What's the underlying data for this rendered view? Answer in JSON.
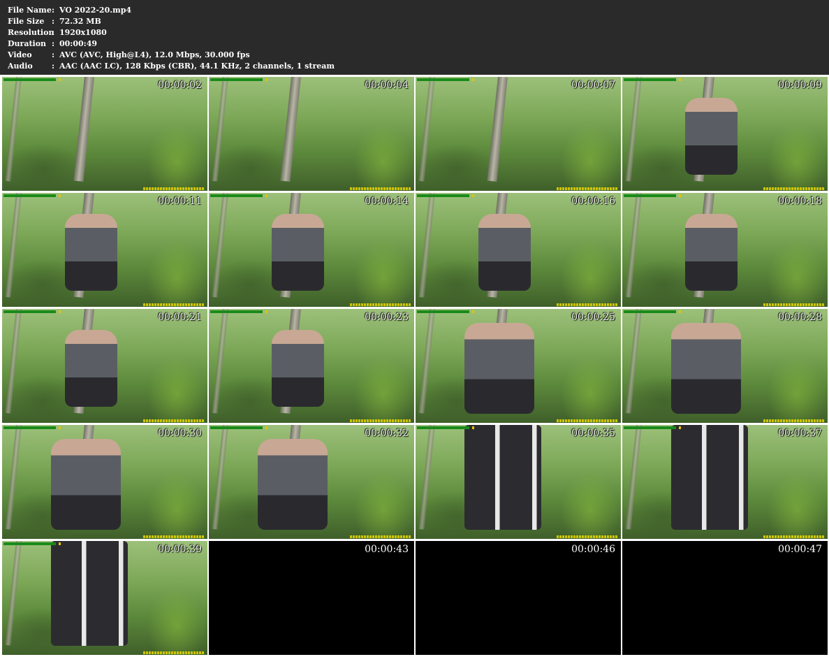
{
  "file_info": [
    {
      "key": "File Name",
      "value": "VO 2022-20.mp4"
    },
    {
      "key": "File Size",
      "value": "72.32 MB"
    },
    {
      "key": "Resolution",
      "value": "1920x1080"
    },
    {
      "key": "Duration",
      "value": "00:00:49"
    },
    {
      "key": "Video",
      "value": "AVC (AVC, High@L4), 12.0 Mbps, 30.000 fps"
    },
    {
      "key": "Audio",
      "value": "AAC (AAC LC), 128 Kbps (CBR), 44.1 KHz, 2 channels, 1 stream"
    }
  ],
  "separator": ":",
  "thumbnails": [
    {
      "timestamp": "00:00:02",
      "scene": "forest"
    },
    {
      "timestamp": "00:00:04",
      "scene": "forest"
    },
    {
      "timestamp": "00:00:07",
      "scene": "forest"
    },
    {
      "timestamp": "00:00:09",
      "scene": "squat"
    },
    {
      "timestamp": "00:00:11",
      "scene": "squat"
    },
    {
      "timestamp": "00:00:14",
      "scene": "squat"
    },
    {
      "timestamp": "00:00:16",
      "scene": "squat"
    },
    {
      "timestamp": "00:00:18",
      "scene": "squat"
    },
    {
      "timestamp": "00:00:21",
      "scene": "squat"
    },
    {
      "timestamp": "00:00:23",
      "scene": "squat"
    },
    {
      "timestamp": "00:00:25",
      "scene": "bend"
    },
    {
      "timestamp": "00:00:28",
      "scene": "bend"
    },
    {
      "timestamp": "00:00:30",
      "scene": "bend"
    },
    {
      "timestamp": "00:00:32",
      "scene": "bend"
    },
    {
      "timestamp": "00:00:35",
      "scene": "standing"
    },
    {
      "timestamp": "00:00:37",
      "scene": "standing"
    },
    {
      "timestamp": "00:00:39",
      "scene": "standing"
    },
    {
      "timestamp": "00:00:43",
      "scene": "black"
    },
    {
      "timestamp": "00:00:46",
      "scene": "black"
    },
    {
      "timestamp": "00:00:47",
      "scene": "black"
    }
  ]
}
